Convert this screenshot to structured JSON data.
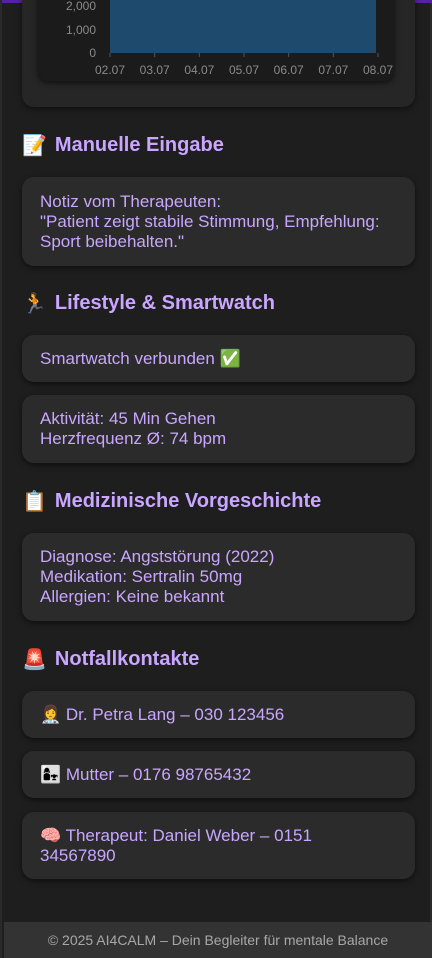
{
  "chart_data": {
    "type": "bar",
    "categories": [
      "02.07",
      "03.07",
      "04.07",
      "05.07",
      "06.07",
      "07.07",
      "08.07"
    ],
    "yticks": [
      "0",
      "1,000",
      "2,000"
    ],
    "colors": {
      "bar": "#1e4a6e",
      "axis_text": "#8a8a8a"
    }
  },
  "sections": {
    "manual": {
      "icon": "📝",
      "title": "Manuelle Eingabe",
      "note_lines": [
        "Notiz vom Therapeuten:",
        "\"Patient zeigt stabile Stimmung, Empfehlung:",
        "Sport beibehalten.\""
      ]
    },
    "lifestyle": {
      "icon": "🏃",
      "title": "Lifestyle & Smartwatch",
      "smartwatch_status": "Smartwatch verbunden ✅",
      "activity": "Aktivität: 45 Min Gehen",
      "heartrate": "Herzfrequenz Ø: 74 bpm"
    },
    "history": {
      "icon": "📋",
      "title": "Medizinische Vorgeschichte",
      "diagnosis": "Diagnose: Angststörung (2022)",
      "medication": "Medikation: Sertralin 50mg",
      "allergies": "Allergien: Keine bekannt"
    },
    "emergency": {
      "icon": "🚨",
      "title": "Notfallkontakte",
      "contacts": [
        {
          "text": "👩‍⚕️ Dr. Petra Lang – 030 123456"
        },
        {
          "text": "👩‍👧 Mutter – 0176 98765432"
        },
        {
          "line1": "🧠 Therapeut: Daniel Weber – 0151",
          "line2": "34567890"
        }
      ]
    }
  },
  "footer": {
    "text": "© 2025 AI4CALM – Dein Begleiter für mentale Balance"
  },
  "colors": {
    "accent": "#c9a6ff",
    "topbar": "#5a1fa8",
    "card": "#2b2b2b",
    "background": "#1e1e1e"
  }
}
